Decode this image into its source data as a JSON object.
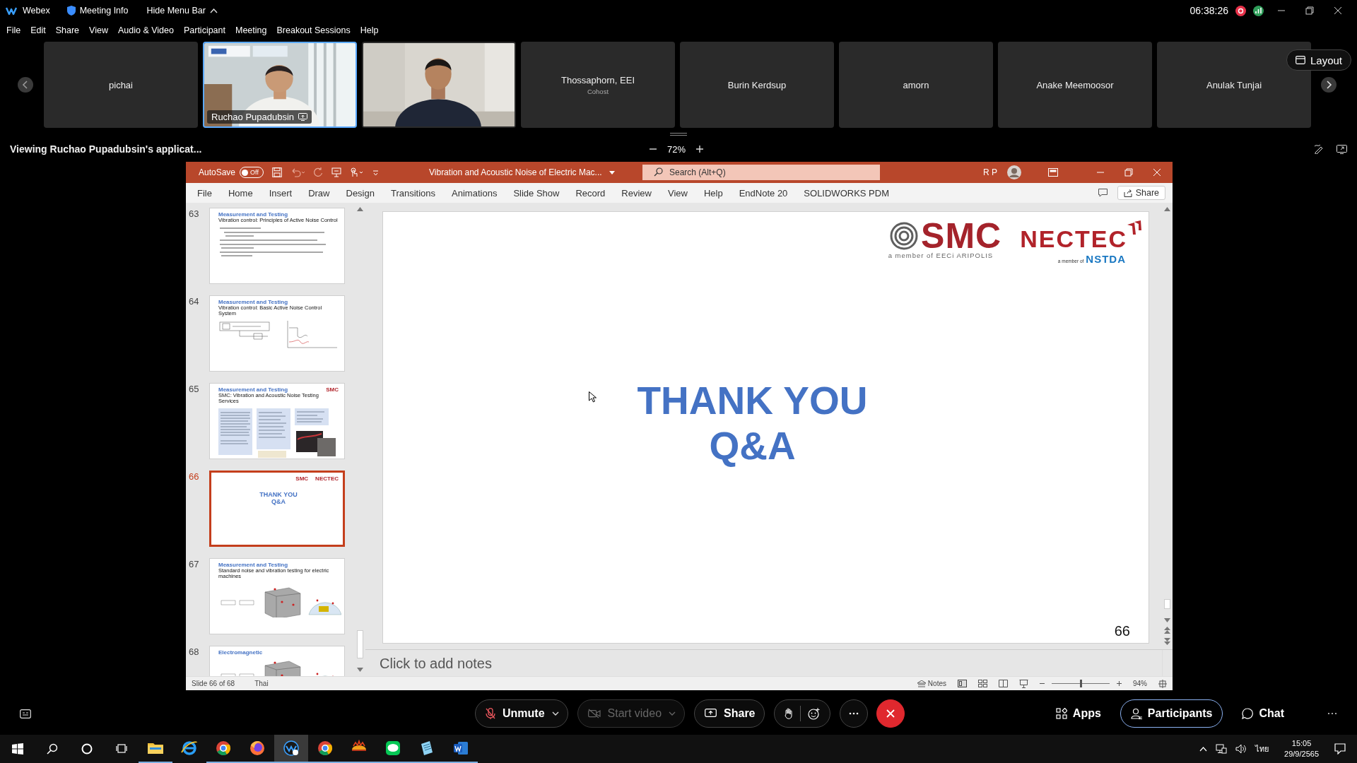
{
  "titlebar": {
    "app": "Webex",
    "meeting_info": "Meeting Info",
    "hide_menu": "Hide Menu Bar",
    "clock": "06:38:26",
    "recording": true
  },
  "menu": [
    "File",
    "Edit",
    "Share",
    "View",
    "Audio & Video",
    "Participant",
    "Meeting",
    "Breakout Sessions",
    "Help"
  ],
  "participants": [
    {
      "name": "pichai",
      "kind": "name",
      "selected": false
    },
    {
      "name": "Ruchao Pupadubsin",
      "kind": "video",
      "selected": true,
      "sharing": true
    },
    {
      "kind": "video",
      "selected": false
    },
    {
      "name": "Thossaphorn, EEI",
      "role": "Cohost",
      "kind": "name",
      "selected": false
    },
    {
      "name": "Burin Kerdsup",
      "kind": "name",
      "selected": false
    },
    {
      "name": "amorn",
      "kind": "name",
      "selected": false
    },
    {
      "name": "Anake Meemoosor",
      "kind": "name",
      "selected": false
    },
    {
      "name": "Anulak Tunjai",
      "kind": "name",
      "selected": false
    }
  ],
  "layout_button": "Layout",
  "viewing": "Viewing Ruchao Pupadubsin's applicat...",
  "zoom": "72%",
  "presentation": {
    "autosave": {
      "label": "AutoSave",
      "state": "Off",
      "on": false
    },
    "title": "Vibration and Acoustic Noise of Electric Mac...",
    "search": {
      "placeholder": "Search (Alt+Q)"
    },
    "user": "R P",
    "ribbon": [
      "File",
      "Home",
      "Insert",
      "Draw",
      "Design",
      "Transitions",
      "Animations",
      "Slide Show",
      "Record",
      "Review",
      "View",
      "Help",
      "EndNote 20",
      "SOLIDWORKS PDM"
    ],
    "share": "Share",
    "thumbnails": [
      {
        "number": "63",
        "kind": "text",
        "selected": false,
        "title": "Measurement and Testing",
        "subtitle": "Vibration control: Principles of Active Noise Control"
      },
      {
        "number": "64",
        "kind": "diagram",
        "selected": false,
        "title": "Measurement and Testing",
        "subtitle": "Vibration control: Basic Active Noise Control System"
      },
      {
        "number": "65",
        "kind": "services",
        "selected": false,
        "title": "Measurement and Testing",
        "subtitle": "SMC: Vibration and Acoustic Noise Testing Services",
        "logo": "SMC"
      },
      {
        "number": "66",
        "kind": "closing",
        "selected": true,
        "logo": "SMC",
        "logo2": "NECTEC",
        "lines": [
          "THANK YOU",
          "Q&A"
        ]
      },
      {
        "number": "67",
        "kind": "figures",
        "selected": false,
        "title": "Measurement and Testing",
        "subtitle": "Standard noise and vibration testing for electric machines"
      },
      {
        "number": "68",
        "kind": "figures",
        "selected": false,
        "title": "Electromagnetic"
      }
    ],
    "slide": {
      "smc": "SMC",
      "smc_tagline": "a member of EECi ARIPOLIS",
      "nectec": "NECTEC",
      "nectec_tagline": "a member of",
      "nstda": "NSTDA",
      "lines": [
        "THANK YOU",
        "Q&A"
      ],
      "number": "66"
    },
    "notes": {
      "placeholder": "Click to add notes"
    },
    "status": {
      "slide": "Slide 66 of 68",
      "language": "Thai",
      "notes": "Notes",
      "zoom": "94%",
      "level": 0.5
    }
  },
  "controls": [
    {
      "kind": "mute",
      "label": "Unmute",
      "caret": true
    },
    {
      "kind": "video",
      "label": "Start video",
      "caret": true,
      "disabled": true
    },
    {
      "kind": "share",
      "label": "Share"
    },
    {
      "kind": "reactions"
    },
    {
      "kind": "more"
    },
    {
      "kind": "leave"
    }
  ],
  "side_controls": [
    {
      "kind": "apps",
      "label": "Apps",
      "selected": false
    },
    {
      "kind": "participants",
      "label": "Participants",
      "selected": true
    },
    {
      "kind": "chat",
      "label": "Chat",
      "selected": false
    }
  ],
  "taskbar": {
    "apps": [
      {
        "kind": "explorer",
        "open": true,
        "selected": false
      },
      {
        "kind": "ie",
        "open": false,
        "selected": false
      },
      {
        "kind": "chrome",
        "open": true,
        "selected": false
      },
      {
        "kind": "firefox",
        "open": true,
        "selected": false
      },
      {
        "kind": "webex",
        "open": true,
        "selected": true
      },
      {
        "kind": "chrome",
        "open": true,
        "selected": false
      },
      {
        "kind": "sun",
        "open": true,
        "selected": false
      },
      {
        "kind": "line",
        "open": true,
        "selected": false
      },
      {
        "kind": "notepad",
        "open": true,
        "selected": false
      },
      {
        "kind": "word",
        "open": true,
        "selected": false
      }
    ],
    "language": "ไทย",
    "time": "15:05",
    "date": "29/9/2565"
  }
}
